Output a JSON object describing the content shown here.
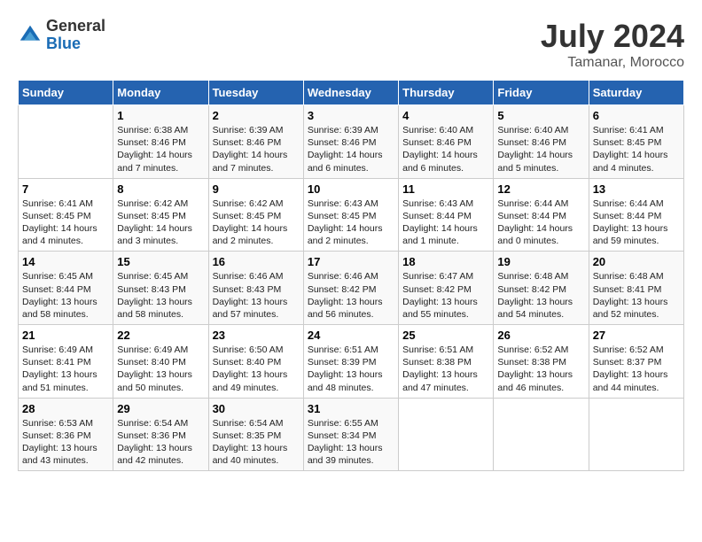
{
  "logo": {
    "general": "General",
    "blue": "Blue"
  },
  "title": "July 2024",
  "subtitle": "Tamanar, Morocco",
  "days_of_week": [
    "Sunday",
    "Monday",
    "Tuesday",
    "Wednesday",
    "Thursday",
    "Friday",
    "Saturday"
  ],
  "weeks": [
    [
      {
        "day": "",
        "info": ""
      },
      {
        "day": "1",
        "info": "Sunrise: 6:38 AM\nSunset: 8:46 PM\nDaylight: 14 hours\nand 7 minutes."
      },
      {
        "day": "2",
        "info": "Sunrise: 6:39 AM\nSunset: 8:46 PM\nDaylight: 14 hours\nand 7 minutes."
      },
      {
        "day": "3",
        "info": "Sunrise: 6:39 AM\nSunset: 8:46 PM\nDaylight: 14 hours\nand 6 minutes."
      },
      {
        "day": "4",
        "info": "Sunrise: 6:40 AM\nSunset: 8:46 PM\nDaylight: 14 hours\nand 6 minutes."
      },
      {
        "day": "5",
        "info": "Sunrise: 6:40 AM\nSunset: 8:46 PM\nDaylight: 14 hours\nand 5 minutes."
      },
      {
        "day": "6",
        "info": "Sunrise: 6:41 AM\nSunset: 8:45 PM\nDaylight: 14 hours\nand 4 minutes."
      }
    ],
    [
      {
        "day": "7",
        "info": "Sunrise: 6:41 AM\nSunset: 8:45 PM\nDaylight: 14 hours\nand 4 minutes."
      },
      {
        "day": "8",
        "info": "Sunrise: 6:42 AM\nSunset: 8:45 PM\nDaylight: 14 hours\nand 3 minutes."
      },
      {
        "day": "9",
        "info": "Sunrise: 6:42 AM\nSunset: 8:45 PM\nDaylight: 14 hours\nand 2 minutes."
      },
      {
        "day": "10",
        "info": "Sunrise: 6:43 AM\nSunset: 8:45 PM\nDaylight: 14 hours\nand 2 minutes."
      },
      {
        "day": "11",
        "info": "Sunrise: 6:43 AM\nSunset: 8:44 PM\nDaylight: 14 hours\nand 1 minute."
      },
      {
        "day": "12",
        "info": "Sunrise: 6:44 AM\nSunset: 8:44 PM\nDaylight: 14 hours\nand 0 minutes."
      },
      {
        "day": "13",
        "info": "Sunrise: 6:44 AM\nSunset: 8:44 PM\nDaylight: 13 hours\nand 59 minutes."
      }
    ],
    [
      {
        "day": "14",
        "info": "Sunrise: 6:45 AM\nSunset: 8:44 PM\nDaylight: 13 hours\nand 58 minutes."
      },
      {
        "day": "15",
        "info": "Sunrise: 6:45 AM\nSunset: 8:43 PM\nDaylight: 13 hours\nand 58 minutes."
      },
      {
        "day": "16",
        "info": "Sunrise: 6:46 AM\nSunset: 8:43 PM\nDaylight: 13 hours\nand 57 minutes."
      },
      {
        "day": "17",
        "info": "Sunrise: 6:46 AM\nSunset: 8:42 PM\nDaylight: 13 hours\nand 56 minutes."
      },
      {
        "day": "18",
        "info": "Sunrise: 6:47 AM\nSunset: 8:42 PM\nDaylight: 13 hours\nand 55 minutes."
      },
      {
        "day": "19",
        "info": "Sunrise: 6:48 AM\nSunset: 8:42 PM\nDaylight: 13 hours\nand 54 minutes."
      },
      {
        "day": "20",
        "info": "Sunrise: 6:48 AM\nSunset: 8:41 PM\nDaylight: 13 hours\nand 52 minutes."
      }
    ],
    [
      {
        "day": "21",
        "info": "Sunrise: 6:49 AM\nSunset: 8:41 PM\nDaylight: 13 hours\nand 51 minutes."
      },
      {
        "day": "22",
        "info": "Sunrise: 6:49 AM\nSunset: 8:40 PM\nDaylight: 13 hours\nand 50 minutes."
      },
      {
        "day": "23",
        "info": "Sunrise: 6:50 AM\nSunset: 8:40 PM\nDaylight: 13 hours\nand 49 minutes."
      },
      {
        "day": "24",
        "info": "Sunrise: 6:51 AM\nSunset: 8:39 PM\nDaylight: 13 hours\nand 48 minutes."
      },
      {
        "day": "25",
        "info": "Sunrise: 6:51 AM\nSunset: 8:38 PM\nDaylight: 13 hours\nand 47 minutes."
      },
      {
        "day": "26",
        "info": "Sunrise: 6:52 AM\nSunset: 8:38 PM\nDaylight: 13 hours\nand 46 minutes."
      },
      {
        "day": "27",
        "info": "Sunrise: 6:52 AM\nSunset: 8:37 PM\nDaylight: 13 hours\nand 44 minutes."
      }
    ],
    [
      {
        "day": "28",
        "info": "Sunrise: 6:53 AM\nSunset: 8:36 PM\nDaylight: 13 hours\nand 43 minutes."
      },
      {
        "day": "29",
        "info": "Sunrise: 6:54 AM\nSunset: 8:36 PM\nDaylight: 13 hours\nand 42 minutes."
      },
      {
        "day": "30",
        "info": "Sunrise: 6:54 AM\nSunset: 8:35 PM\nDaylight: 13 hours\nand 40 minutes."
      },
      {
        "day": "31",
        "info": "Sunrise: 6:55 AM\nSunset: 8:34 PM\nDaylight: 13 hours\nand 39 minutes."
      },
      {
        "day": "",
        "info": ""
      },
      {
        "day": "",
        "info": ""
      },
      {
        "day": "",
        "info": ""
      }
    ]
  ]
}
